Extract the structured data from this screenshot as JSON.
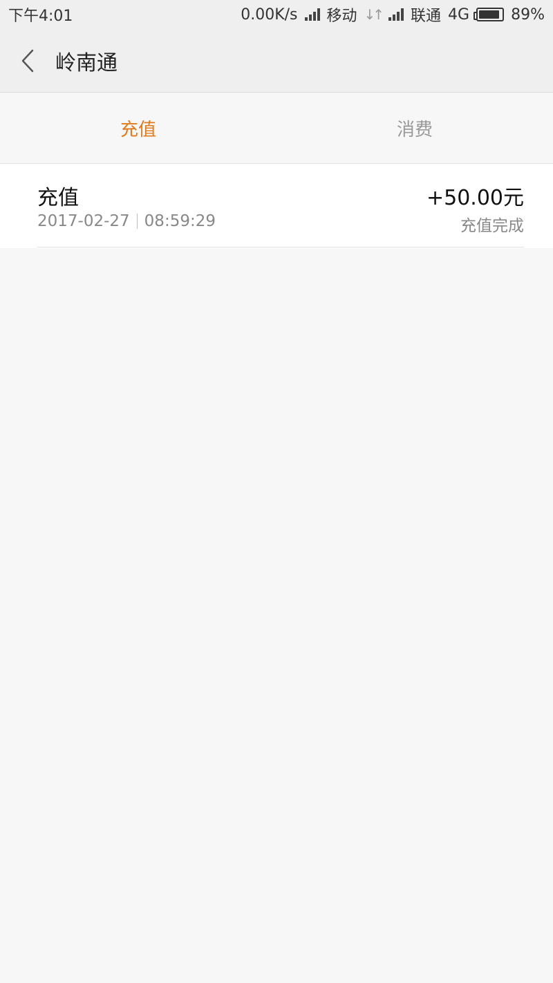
{
  "status_bar": {
    "time": "下午4:01",
    "network_speed": "0.00K/s",
    "carrier1": "移动",
    "carrier2": "联通",
    "network_type": "4G",
    "battery": "89%",
    "battery_level": 0.89
  },
  "header": {
    "title": "岭南通"
  },
  "tabs": [
    {
      "label": "充值",
      "active": true
    },
    {
      "label": "消费",
      "active": false
    }
  ],
  "records": [
    {
      "title": "充值",
      "date": "2017-02-27",
      "time": "08:59:29",
      "amount": "+50.00元",
      "status": "充值完成"
    }
  ],
  "colors": {
    "accent": "#e07a1a",
    "background": "#f7f7f7"
  }
}
